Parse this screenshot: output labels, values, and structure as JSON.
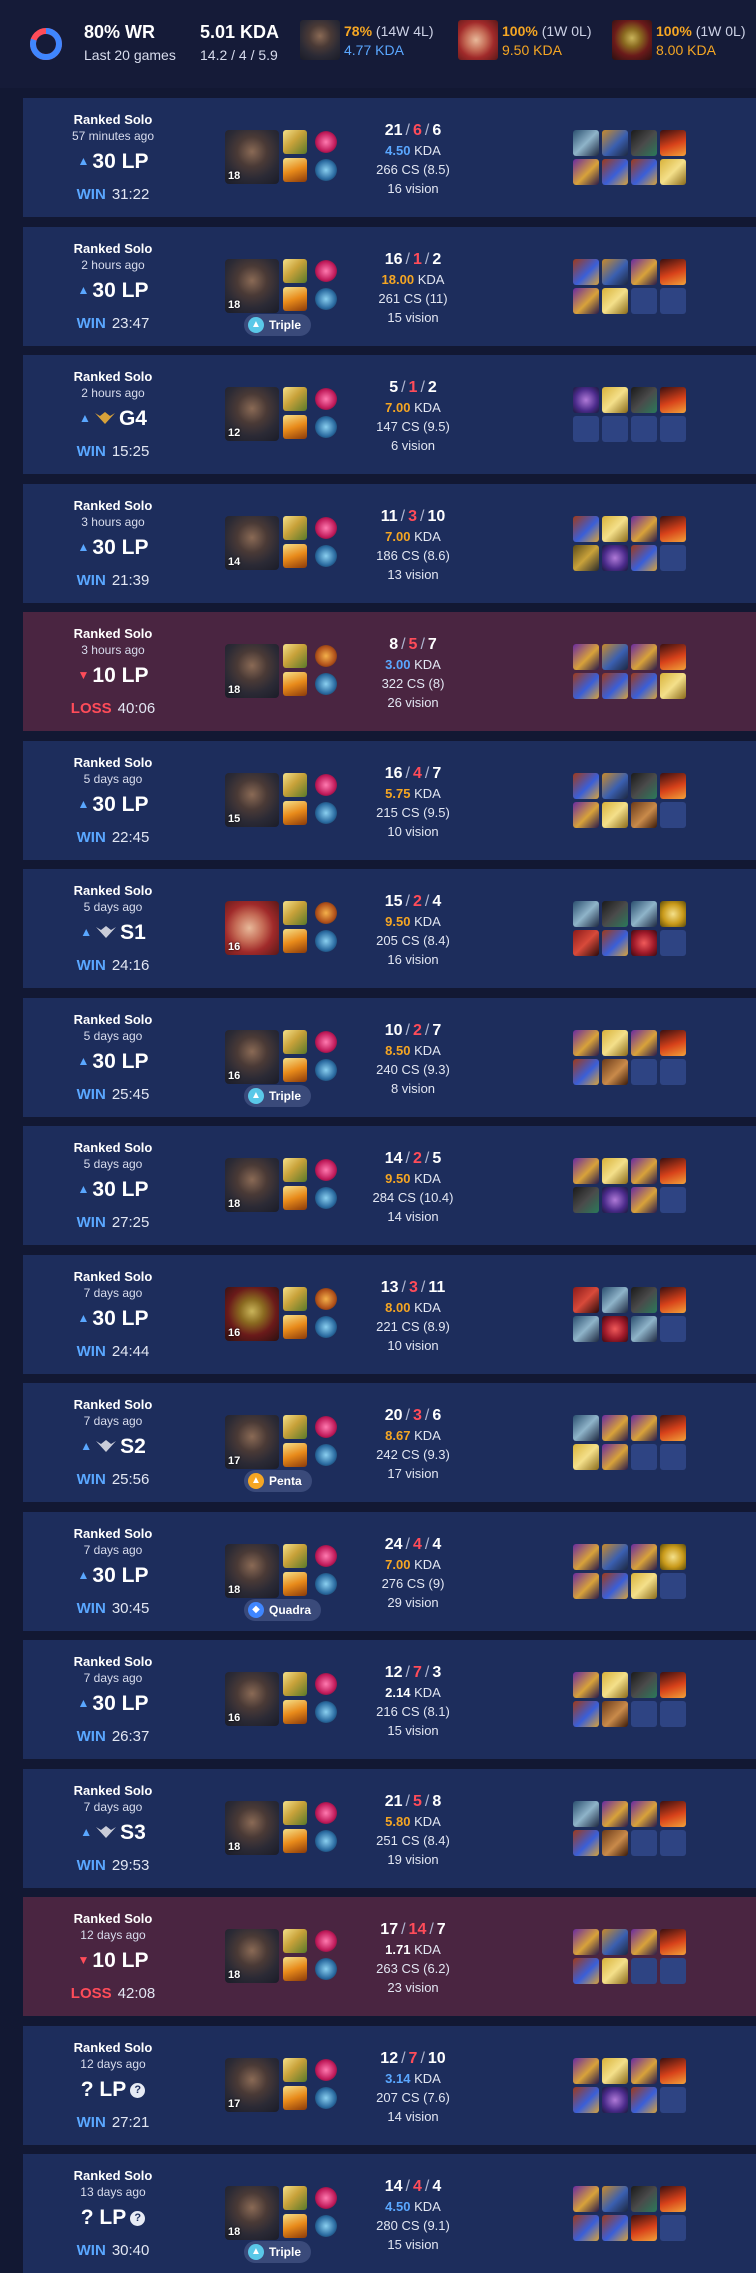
{
  "summary": {
    "winrate_label": "80% WR",
    "winrate_value": 0.8,
    "games_label": "Last 20 games",
    "kda_label": "5.01 KDA",
    "kda_breakdown": "14.2 / 4 / 5.9",
    "champions": [
      {
        "pct": "78%",
        "record": "(14W 4L)",
        "kda": "4.77 KDA",
        "kda_color": "#5aa7ff",
        "portrait_icon": "champion-ekko-portrait"
      },
      {
        "pct": "100%",
        "record": "(1W 0L)",
        "kda": "9.50 KDA",
        "kda_color": "#f5a623",
        "portrait_icon": "champion-red-haired-portrait"
      },
      {
        "pct": "100%",
        "record": "(1W 0L)",
        "kda": "8.00 KDA",
        "kda_color": "#f5a623",
        "portrait_icon": "champion-masked-portrait"
      }
    ]
  },
  "colors": {
    "win": "#5aa7ff",
    "loss": "#ff4c59",
    "gold": "#f5a623",
    "row_win": "#1d2d5c",
    "row_loss": "#4a2541"
  },
  "matches": [
    {
      "queue": "Ranked Solo",
      "ago": "57 minutes ago",
      "lp_dir": "up",
      "lp": "30 LP",
      "result": "WIN",
      "duration": "31:22",
      "level": "18",
      "champion": "ekko",
      "badge": "",
      "kills": "21",
      "deaths": "6",
      "assists": "6",
      "kda": "4.50",
      "kda_label": "KDA",
      "kda_color": "#5aa7ff",
      "cs": "266 CS (8.5)",
      "vision": "16 vision",
      "items": [
        "sword",
        "boots",
        "shadow",
        "volcano",
        "hat",
        "cape",
        "cape",
        "ward"
      ]
    },
    {
      "queue": "Ranked Solo",
      "ago": "2 hours ago",
      "lp_dir": "up",
      "lp": "30 LP",
      "result": "WIN",
      "duration": "23:47",
      "level": "18",
      "champion": "ekko",
      "badge": "Triple",
      "kills": "16",
      "deaths": "1",
      "assists": "2",
      "kda": "18.00",
      "kda_label": "KDA",
      "kda_color": "#f5a623",
      "cs": "261 CS (11)",
      "vision": "15 vision",
      "items": [
        "cape",
        "boots",
        "hat",
        "volcano",
        "hat",
        "ward",
        "",
        ""
      ]
    },
    {
      "queue": "Ranked Solo",
      "ago": "2 hours ago",
      "lp_dir": "up",
      "lp": "G4",
      "result": "WIN",
      "duration": "15:25",
      "level": "12",
      "champion": "ekko",
      "badge": "",
      "kills": "5",
      "deaths": "1",
      "assists": "2",
      "kda": "7.00",
      "kda_label": "KDA",
      "kda_color": "#f5a623",
      "cs": "147 CS (9.5)",
      "vision": "6 vision",
      "items": [
        "orb",
        "ward",
        "shadow",
        "volcano",
        "",
        "",
        "",
        ""
      ]
    },
    {
      "queue": "Ranked Solo",
      "ago": "3 hours ago",
      "lp_dir": "up",
      "lp": "30 LP",
      "result": "WIN",
      "duration": "21:39",
      "level": "14",
      "champion": "ekko",
      "badge": "",
      "kills": "11",
      "deaths": "3",
      "assists": "10",
      "kda": "7.00",
      "kda_label": "KDA",
      "kda_color": "#f5a623",
      "cs": "186 CS (8.6)",
      "vision": "13 vision",
      "items": [
        "cape",
        "ward",
        "hat",
        "volcano",
        "shield",
        "orb",
        "cape",
        ""
      ]
    },
    {
      "queue": "Ranked Solo",
      "ago": "3 hours ago",
      "lp_dir": "down",
      "lp": "10 LP",
      "result": "LOSS",
      "duration": "40:06",
      "level": "18",
      "champion": "ekko",
      "badge": "",
      "kills": "8",
      "deaths": "5",
      "assists": "7",
      "kda": "3.00",
      "kda_label": "KDA",
      "kda_color": "#5aa7ff",
      "cs": "322 CS (8)",
      "vision": "26 vision",
      "items": [
        "hat",
        "boots",
        "hat",
        "volcano",
        "cape",
        "cape",
        "cape",
        "ward"
      ]
    },
    {
      "queue": "Ranked Solo",
      "ago": "5 days ago",
      "lp_dir": "up",
      "lp": "30 LP",
      "result": "WIN",
      "duration": "22:45",
      "level": "15",
      "champion": "ekko",
      "badge": "",
      "kills": "16",
      "deaths": "4",
      "assists": "7",
      "kda": "5.75",
      "kda_label": "KDA",
      "kda_color": "#f5a623",
      "cs": "215 CS (9.5)",
      "vision": "10 vision",
      "items": [
        "cape",
        "boots",
        "shadow",
        "volcano",
        "hat",
        "ward",
        "book",
        ""
      ]
    },
    {
      "queue": "Ranked Solo",
      "ago": "5 days ago",
      "lp_dir": "up",
      "lp": "S1",
      "result": "WIN",
      "duration": "24:16",
      "level": "16",
      "champion": "red",
      "badge": "",
      "kills": "15",
      "deaths": "2",
      "assists": "4",
      "kda": "9.50",
      "kda_label": "KDA",
      "kda_color": "#f5a623",
      "cs": "205 CS (8.4)",
      "vision": "16 vision",
      "items": [
        "sword",
        "shadow",
        "sword",
        "golden",
        "blade",
        "cape",
        "gem",
        ""
      ]
    },
    {
      "queue": "Ranked Solo",
      "ago": "5 days ago",
      "lp_dir": "up",
      "lp": "30 LP",
      "result": "WIN",
      "duration": "25:45",
      "level": "16",
      "champion": "ekko",
      "badge": "Triple",
      "kills": "10",
      "deaths": "2",
      "assists": "7",
      "kda": "8.50",
      "kda_label": "KDA",
      "kda_color": "#f5a623",
      "cs": "240 CS (9.3)",
      "vision": "8 vision",
      "items": [
        "hat",
        "ward",
        "hat",
        "volcano",
        "cape",
        "book",
        "",
        ""
      ]
    },
    {
      "queue": "Ranked Solo",
      "ago": "5 days ago",
      "lp_dir": "up",
      "lp": "30 LP",
      "result": "WIN",
      "duration": "27:25",
      "level": "18",
      "champion": "ekko",
      "badge": "",
      "kills": "14",
      "deaths": "2",
      "assists": "5",
      "kda": "9.50",
      "kda_label": "KDA",
      "kda_color": "#f5a623",
      "cs": "284 CS (10.4)",
      "vision": "14 vision",
      "items": [
        "hat",
        "ward",
        "hat",
        "volcano",
        "shadow",
        "orb",
        "hat",
        ""
      ]
    },
    {
      "queue": "Ranked Solo",
      "ago": "7 days ago",
      "lp_dir": "up",
      "lp": "30 LP",
      "result": "WIN",
      "duration": "24:44",
      "level": "16",
      "champion": "masked",
      "badge": "",
      "kills": "13",
      "deaths": "3",
      "assists": "11",
      "kda": "8.00",
      "kda_label": "KDA",
      "kda_color": "#f5a623",
      "cs": "221 CS (8.9)",
      "vision": "10 vision",
      "items": [
        "blade",
        "sword",
        "shadow",
        "volcano",
        "sword",
        "gem",
        "sword",
        ""
      ]
    },
    {
      "queue": "Ranked Solo",
      "ago": "7 days ago",
      "lp_dir": "up",
      "lp": "S2",
      "result": "WIN",
      "duration": "25:56",
      "level": "17",
      "champion": "ekko",
      "badge": "Penta",
      "kills": "20",
      "deaths": "3",
      "assists": "6",
      "kda": "8.67",
      "kda_label": "KDA",
      "kda_color": "#f5a623",
      "cs": "242 CS (9.3)",
      "vision": "17 vision",
      "items": [
        "sword",
        "hat",
        "hat",
        "volcano",
        "ward",
        "hat",
        "",
        ""
      ]
    },
    {
      "queue": "Ranked Solo",
      "ago": "7 days ago",
      "lp_dir": "up",
      "lp": "30 LP",
      "result": "WIN",
      "duration": "30:45",
      "level": "18",
      "champion": "ekko",
      "badge": "Quadra",
      "kills": "24",
      "deaths": "4",
      "assists": "4",
      "kda": "7.00",
      "kda_label": "KDA",
      "kda_color": "#f5a623",
      "cs": "276 CS (9)",
      "vision": "29 vision",
      "items": [
        "hat",
        "boots",
        "hat",
        "golden",
        "hat",
        "cape",
        "ward",
        ""
      ]
    },
    {
      "queue": "Ranked Solo",
      "ago": "7 days ago",
      "lp_dir": "up",
      "lp": "30 LP",
      "result": "WIN",
      "duration": "26:37",
      "level": "16",
      "champion": "ekko",
      "badge": "",
      "kills": "12",
      "deaths": "7",
      "assists": "3",
      "kda": "2.14",
      "kda_label": "KDA",
      "kda_color": "#ffffff",
      "cs": "216 CS (8.1)",
      "vision": "15 vision",
      "items": [
        "hat",
        "ward",
        "shadow",
        "volcano",
        "cape",
        "book",
        "",
        ""
      ]
    },
    {
      "queue": "Ranked Solo",
      "ago": "7 days ago",
      "lp_dir": "up",
      "lp": "S3",
      "result": "WIN",
      "duration": "29:53",
      "level": "18",
      "champion": "ekko",
      "badge": "",
      "kills": "21",
      "deaths": "5",
      "assists": "8",
      "kda": "5.80",
      "kda_label": "KDA",
      "kda_color": "#f5a623",
      "cs": "251 CS (8.4)",
      "vision": "19 vision",
      "items": [
        "sword",
        "hat",
        "hat",
        "volcano",
        "cape",
        "book",
        "",
        ""
      ]
    },
    {
      "queue": "Ranked Solo",
      "ago": "12 days ago",
      "lp_dir": "down",
      "lp": "10 LP",
      "result": "LOSS",
      "duration": "42:08",
      "level": "18",
      "champion": "ekko",
      "badge": "",
      "kills": "17",
      "deaths": "14",
      "assists": "7",
      "kda": "1.71",
      "kda_label": "KDA",
      "kda_color": "#ffffff",
      "cs": "263 CS (6.2)",
      "vision": "23 vision",
      "items": [
        "hat",
        "boots",
        "hat",
        "volcano",
        "cape",
        "ward",
        "",
        ""
      ]
    },
    {
      "queue": "Ranked Solo",
      "ago": "12 days ago",
      "lp_dir": "none",
      "lp": "? LP",
      "result": "WIN",
      "duration": "27:21",
      "level": "17",
      "champion": "ekko",
      "badge": "",
      "kills": "12",
      "deaths": "7",
      "assists": "10",
      "kda": "3.14",
      "kda_label": "KDA",
      "kda_color": "#5aa7ff",
      "cs": "207 CS (7.6)",
      "vision": "14 vision",
      "items": [
        "hat",
        "ward",
        "hat",
        "volcano",
        "cape",
        "orb",
        "cape",
        ""
      ]
    },
    {
      "queue": "Ranked Solo",
      "ago": "13 days ago",
      "lp_dir": "none",
      "lp": "? LP",
      "result": "WIN",
      "duration": "30:40",
      "level": "18",
      "champion": "ekko",
      "badge": "Triple",
      "kills": "14",
      "deaths": "4",
      "assists": "4",
      "kda": "4.50",
      "kda_label": "KDA",
      "kda_color": "#5aa7ff",
      "cs": "280 CS (9.1)",
      "vision": "15 vision",
      "items": [
        "hat",
        "boots",
        "shadow",
        "volcano",
        "cape",
        "cape",
        "volcano",
        ""
      ]
    }
  ]
}
